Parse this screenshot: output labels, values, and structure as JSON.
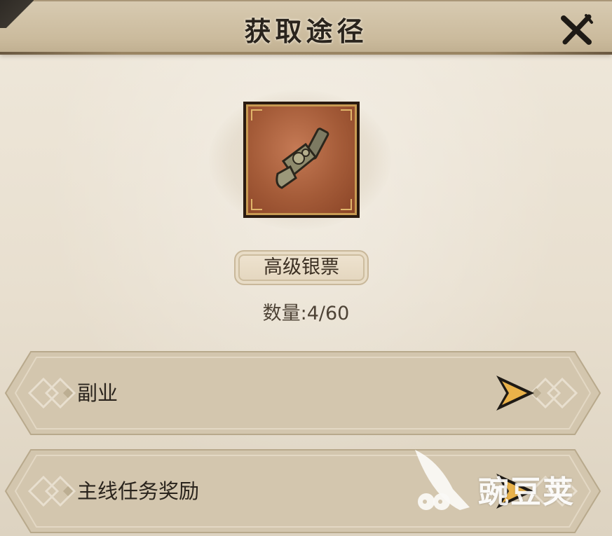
{
  "dialog": {
    "title": "获取途径",
    "close_icon": "close-x-icon"
  },
  "item": {
    "icon": "ornate-key-icon",
    "name": "高级银票",
    "quantity_text": "数量:4/60"
  },
  "sources": [
    {
      "label": "副业",
      "icon": "arrow-right-icon"
    },
    {
      "label": "主线任务奖励",
      "icon": "arrow-right-icon"
    }
  ],
  "watermark": {
    "text": "豌豆荚",
    "icon": "pea-pod-logo-icon"
  },
  "colors": {
    "header": "#cbbb9d",
    "parchment": "#e9e1d2",
    "row": "#d2c5ad",
    "item_bg": "#a45b38",
    "arrow_gold": "#e9b24a"
  }
}
